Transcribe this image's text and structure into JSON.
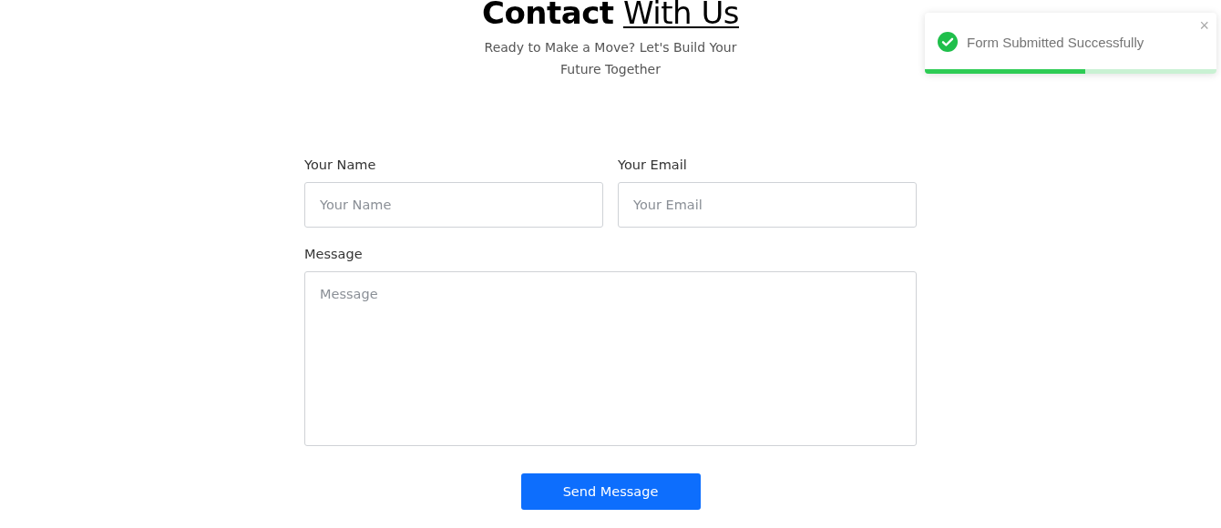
{
  "heading": {
    "bold_part": "Contact",
    "underlined_part": "With Us"
  },
  "subtitle": "Ready to Make a Move? Let's Build Your Future Together",
  "form": {
    "fields": [
      {
        "kind": "input",
        "label": "Your Name",
        "placeholder": "Your Name"
      },
      {
        "kind": "input",
        "label": "Your Email",
        "placeholder": "Your Email"
      },
      {
        "kind": "textarea",
        "label": "Message",
        "placeholder": "Message"
      }
    ],
    "submit": "Send Message"
  },
  "toast": {
    "message": "Form Submitted Successfully",
    "close": "×",
    "level": 0.55
  }
}
